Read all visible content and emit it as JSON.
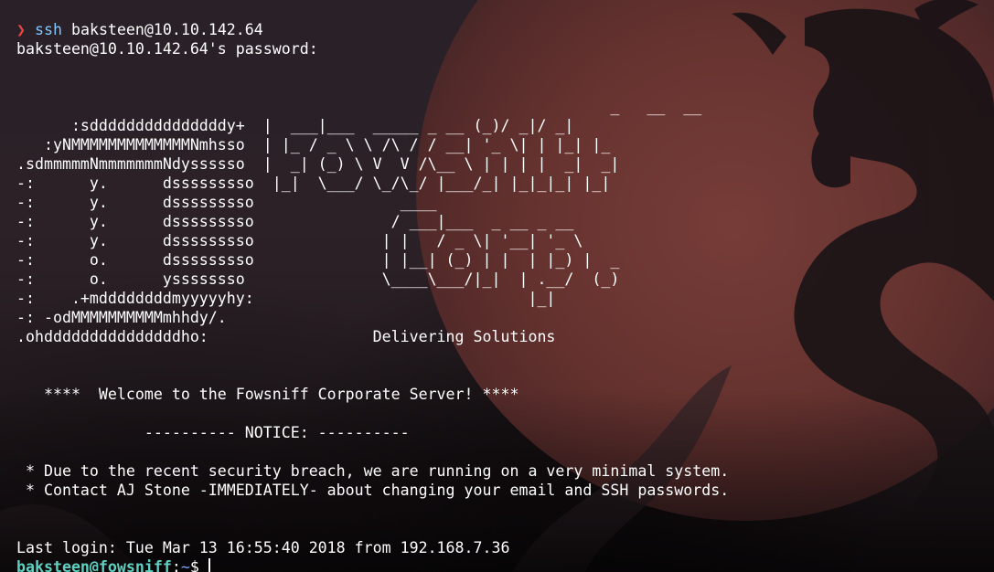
{
  "terminal": {
    "prompt_arrow": "❯",
    "command_name": "ssh",
    "command_args": " baksteen@10.10.142.64",
    "password_prompt": "baksteen@10.10.142.64's password:",
    "banner_lines": [
      "",
      "",
      "                                                                 _   __  __",
      "      :sdddddddddddddddy+  |  ___|___  _____ _ __ (_)/ _|/ _|",
      "   :yNMMMMMMMMMMMMMNmhsso  | |_ / _ \\ \\ /\\ / / __| '_ \\| | |_| |_",
      ".sdmmmmmNmmmmmmmNdyssssso  |  _| (_) \\ V  V /\\__ \\ | | | |  _|  _|",
      "-:      y.      dsssssssso  |_|  \\___/ \\_/\\_/ |___/_| |_|_|_| |_|",
      "-:      y.      dsssssssso                ____",
      "-:      y.      dsssssssso               / ___|___  _ __ _ __",
      "-:      y.      dsssssssso              | |   / _ \\| '__| '_ \\",
      "-:      o.      dsssssssso              | |__| (_) | |  | |_) |  _",
      "-:      o.      yssssssso               \\____\\___/|_|  | .__/  (_)",
      "-:    .+mddddddddmyyyyyhy:                              |_|",
      "-: -odMMMMMMMMMMmhhdy/.",
      ".ohdddddddddddddddho:                  Delivering Solutions",
      "",
      "",
      "   ****  Welcome to the Fowsniff Corporate Server! ****",
      "",
      "              ---------- NOTICE: ----------",
      "",
      " * Due to the recent security breach, we are running on a very minimal system.",
      " * Contact AJ Stone -IMMEDIATELY- about changing your email and SSH passwords.",
      "",
      ""
    ],
    "last_login": "Last login: Tue Mar 13 16:55:40 2018 from 192.168.7.36",
    "shell_user": "baksteen@fowsniff",
    "shell_sep": ":",
    "shell_path": "~",
    "shell_symbol": "$ "
  },
  "colors": {
    "arrow": "#e8473e",
    "command": "#7fc8ff",
    "user": "#5fd0c0",
    "path": "#7aa8ff",
    "text": "#ffffff"
  }
}
